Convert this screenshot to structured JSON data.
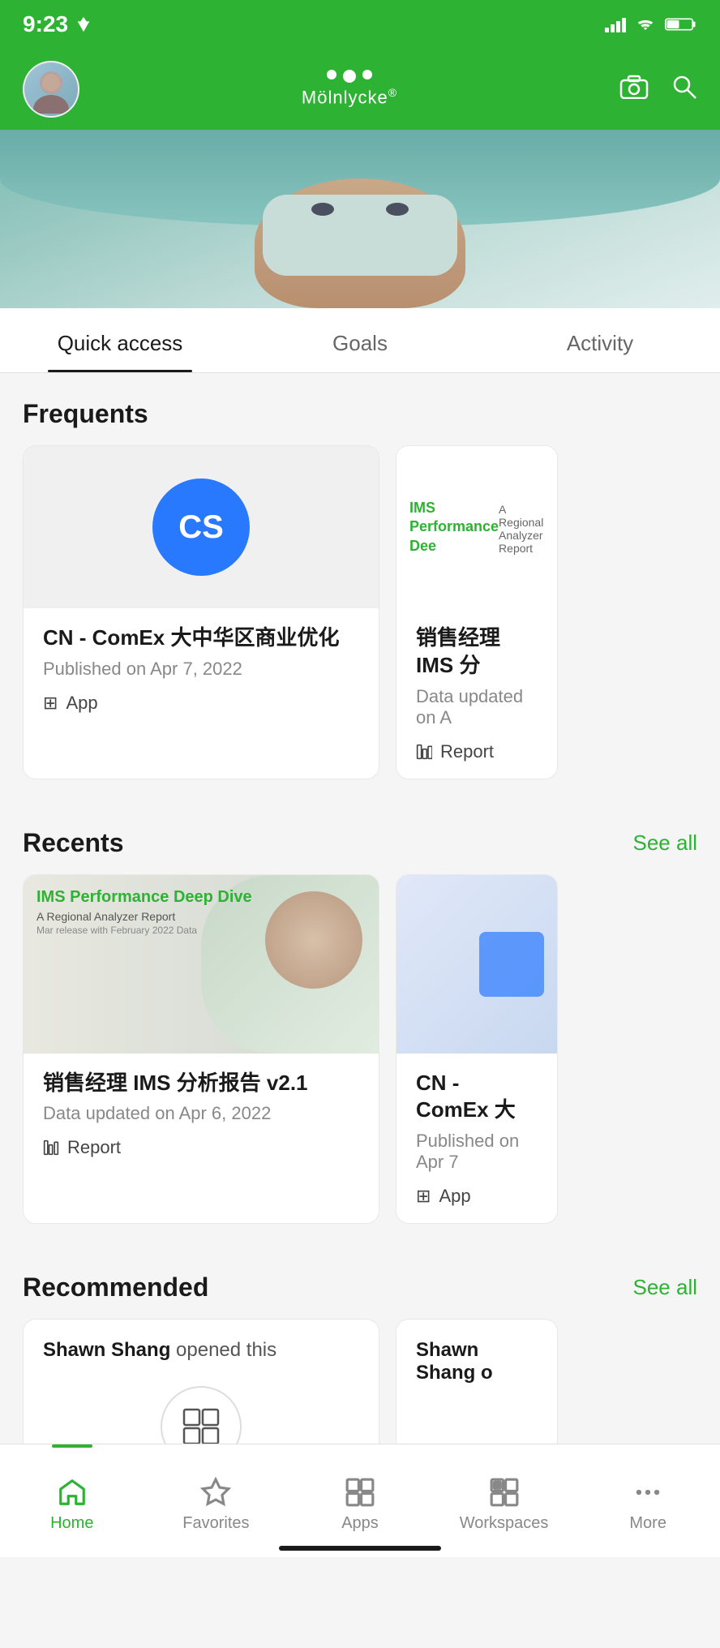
{
  "statusBar": {
    "time": "9:23",
    "hasLocation": true
  },
  "header": {
    "logoText": "Mölnlycke",
    "cameraLabel": "camera",
    "searchLabel": "search"
  },
  "tabs": [
    {
      "id": "quick-access",
      "label": "Quick access",
      "active": true
    },
    {
      "id": "goals",
      "label": "Goals",
      "active": false
    },
    {
      "id": "activity",
      "label": "Activity",
      "active": false
    }
  ],
  "frequents": {
    "title": "Frequents",
    "items": [
      {
        "id": "comex",
        "initials": "CS",
        "title": "CN - ComEx 大中华区商业优化",
        "meta": "Published on Apr 7, 2022",
        "type": "App"
      },
      {
        "id": "ims-report",
        "title": "销售经理 IMS 分",
        "meta": "Data updated on A",
        "type": "Report"
      }
    ]
  },
  "recents": {
    "title": "Recents",
    "seeAllLabel": "See all",
    "items": [
      {
        "id": "ims-report-full",
        "reportTitle": "IMS Performance Deep Dive",
        "reportSubtitle": "A Regional Analyzer Report",
        "reportSmall": "Mar release with February 2022 Data",
        "title": "销售经理 IMS 分析报告 v2.1",
        "meta": "Data updated on Apr 6, 2022",
        "type": "Report"
      },
      {
        "id": "comex-recent",
        "title": "CN - ComEx 大",
        "meta": "Published on Apr 7",
        "type": "App"
      }
    ]
  },
  "recommended": {
    "title": "Recommended",
    "seeAllLabel": "See all",
    "items": [
      {
        "id": "rec1",
        "openedBy": "Shawn Shang",
        "openedText": "opened this"
      },
      {
        "id": "rec2",
        "openedBy": "Shawn Shang o",
        "openedText": ""
      }
    ]
  },
  "bottomNav": [
    {
      "id": "home",
      "label": "Home",
      "icon": "⌂",
      "active": true
    },
    {
      "id": "favorites",
      "label": "Favorites",
      "icon": "☆",
      "active": false
    },
    {
      "id": "apps",
      "label": "Apps",
      "icon": "⊞",
      "active": false
    },
    {
      "id": "workspaces",
      "label": "Workspaces",
      "icon": "⧉",
      "active": false
    },
    {
      "id": "more",
      "label": "More",
      "icon": "···",
      "active": false
    }
  ]
}
